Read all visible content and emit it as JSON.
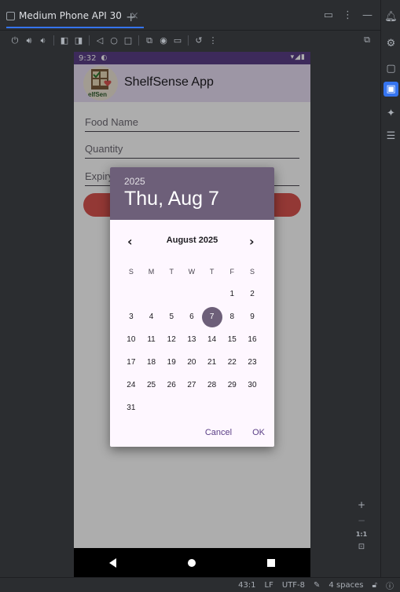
{
  "ide": {
    "tab_title": "Medium Phone API 30",
    "tab_close": "×",
    "tab_add": "+",
    "window_buttons": [
      "▭",
      "⋮",
      "—"
    ],
    "toolbar_icons": [
      "power-icon",
      "volume-up-icon",
      "volume-down-icon",
      "rotate-left-icon",
      "rotate-right-icon",
      "back-icon",
      "home-icon",
      "overview-icon",
      "fold-icon",
      "screenshot-icon",
      "screenrecord-icon",
      "undo-icon",
      "more-icon"
    ],
    "status": {
      "position": "43:1",
      "line_sep": "LF",
      "encoding": "UTF-8",
      "indent": "4 spaces"
    },
    "zoom": {
      "plus": "+",
      "minus": "−",
      "ratio": "1:1"
    }
  },
  "phone": {
    "time": "9:32",
    "status_icons": "▾◢▮",
    "app_title": "ShelfSense App",
    "logo_text": "elfSen",
    "fields": {
      "food_name": "Food Name",
      "quantity": "Quantity",
      "expiry": "Expiry"
    }
  },
  "dialog": {
    "year": "2025",
    "selected_date": "Thu, Aug 7",
    "month_label": "August 2025",
    "prev": "‹",
    "next": "›",
    "weekdays": [
      "S",
      "M",
      "T",
      "W",
      "T",
      "F",
      "S"
    ],
    "weeks": [
      [
        "",
        "",
        "",
        "",
        "",
        "1",
        "2"
      ],
      [
        "3",
        "4",
        "5",
        "6",
        "7",
        "8",
        "9"
      ],
      [
        "10",
        "11",
        "12",
        "13",
        "14",
        "15",
        "16"
      ],
      [
        "17",
        "18",
        "19",
        "20",
        "21",
        "22",
        "23"
      ],
      [
        "24",
        "25",
        "26",
        "27",
        "28",
        "29",
        "30"
      ],
      [
        "31",
        "",
        "",
        "",
        "",
        "",
        ""
      ]
    ],
    "selected_day": "7",
    "cancel": "Cancel",
    "ok": "OK"
  },
  "colors": {
    "accent": "#3574f0",
    "dialog_header": "#6d5f79",
    "status_bar": "#5a3e86",
    "add_button": "#d9534f"
  }
}
